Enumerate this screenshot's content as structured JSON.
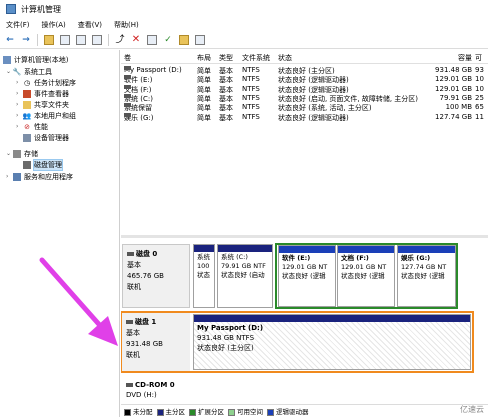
{
  "window": {
    "title": "计算机管理"
  },
  "menu": [
    "文件(F)",
    "操作(A)",
    "查看(V)",
    "帮助(H)"
  ],
  "tree": {
    "root": "计算机管理(本地)",
    "system_tools": "系统工具",
    "task_scheduler": "任务计划程序",
    "event_viewer": "事件查看器",
    "shared_folders": "共享文件夹",
    "local_users": "本地用户和组",
    "performance": "性能",
    "device_manager": "设备管理器",
    "storage": "存储",
    "disk_management": "磁盘管理",
    "services": "服务和应用程序"
  },
  "volume_list": {
    "headers": [
      "卷",
      "布局",
      "类型",
      "文件系统",
      "状态",
      "容量",
      "可"
    ],
    "rows": [
      {
        "vol": "My Passport (D:)",
        "layout": "简单",
        "type": "基本",
        "fs": "NTFS",
        "status": "状态良好 (主分区)",
        "cap": "931.48 GB",
        "free": "93"
      },
      {
        "vol": "软件 (E:)",
        "layout": "简单",
        "type": "基本",
        "fs": "NTFS",
        "status": "状态良好 (逻辑驱动器)",
        "cap": "129.01 GB",
        "free": "10"
      },
      {
        "vol": "文档 (F:)",
        "layout": "简单",
        "type": "基本",
        "fs": "NTFS",
        "status": "状态良好 (逻辑驱动器)",
        "cap": "129.01 GB",
        "free": "10"
      },
      {
        "vol": "系统 (C:)",
        "layout": "简单",
        "type": "基本",
        "fs": "NTFS",
        "status": "状态良好 (启动, 页面文件, 故障转储, 主分区)",
        "cap": "79.91 GB",
        "free": "25"
      },
      {
        "vol": "系统保留",
        "layout": "简单",
        "type": "基本",
        "fs": "NTFS",
        "status": "状态良好 (系统, 活动, 主分区)",
        "cap": "100 MB",
        "free": "65"
      },
      {
        "vol": "娱乐 (G:)",
        "layout": "简单",
        "type": "基本",
        "fs": "NTFS",
        "status": "状态良好 (逻辑驱动器)",
        "cap": "127.74 GB",
        "free": "11"
      }
    ]
  },
  "disks": {
    "disk0": {
      "name": "磁盘 0",
      "type": "基本",
      "size": "465.76 GB",
      "state": "联机",
      "partitions": [
        {
          "name": "系统",
          "line2": "100",
          "line3": "状态"
        },
        {
          "name": "系统 (C:)",
          "line2": "79.91 GB NTF",
          "line3": "状态良好 (启动"
        },
        {
          "name": "软件 (E:)",
          "line2": "129.01 GB NT",
          "line3": "状态良好 (逻辑"
        },
        {
          "name": "文档 (F:)",
          "line2": "129.01 GB NT",
          "line3": "状态良好 (逻辑"
        },
        {
          "name": "娱乐 (G:)",
          "line2": "127.74 GB NT",
          "line3": "状态良好 (逻辑"
        }
      ]
    },
    "disk1": {
      "name": "磁盘 1",
      "type": "基本",
      "size": "931.48 GB",
      "state": "联机",
      "partition": {
        "name": "My Passport (D:)",
        "line2": "931.48 GB NTFS",
        "line3": "状态良好 (主分区)"
      }
    },
    "cdrom": {
      "name": "CD-ROM 0",
      "drive": "DVD (H:)"
    }
  },
  "legend": [
    "未分配",
    "主分区",
    "扩展分区",
    "可用空间",
    "逻辑驱动器"
  ],
  "legend_colors": [
    "#000000",
    "#1a237e",
    "#2a8a2a",
    "#8fd18f",
    "#1a3fb8"
  ],
  "watermark": "亿速云"
}
